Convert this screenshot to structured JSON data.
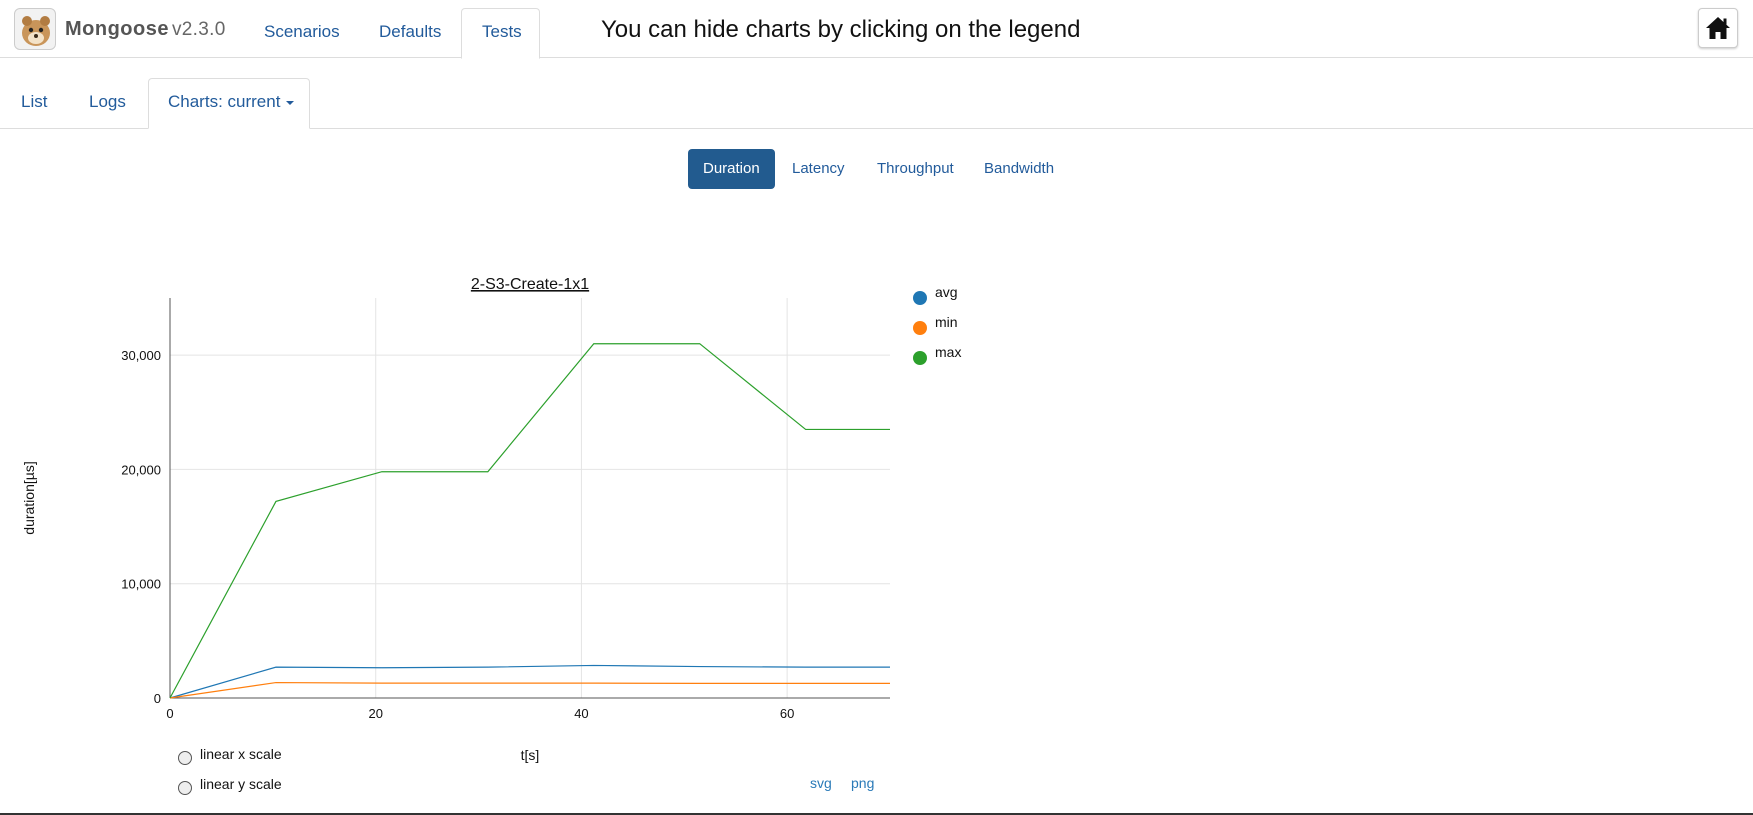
{
  "app": {
    "brand": "Mongoose",
    "version": "v2.3.0",
    "hint": "You can hide charts by clicking on the legend"
  },
  "topnav": {
    "items": [
      "Scenarios",
      "Defaults",
      "Tests"
    ],
    "active": "Tests"
  },
  "subtabs": {
    "items": [
      "List",
      "Logs",
      "Charts: current"
    ],
    "active": "Charts: current"
  },
  "metrics": {
    "items": [
      "Duration",
      "Latency",
      "Throughput",
      "Bandwidth"
    ],
    "active": "Duration"
  },
  "controls": {
    "linear_x": "linear x scale",
    "linear_y": "linear y scale",
    "export_svg": "svg",
    "export_png": "png"
  },
  "colors": {
    "avg": "#1f77b4",
    "min": "#ff7f0e",
    "max": "#2ca02c",
    "accent": "#225b8f"
  },
  "chart_data": {
    "type": "line",
    "title": "2-S3-Create-1x1",
    "xlabel": "t[s]",
    "ylabel": "duration[µs]",
    "xlim": [
      0,
      70
    ],
    "ylim": [
      0,
      35000
    ],
    "xticks": [
      0,
      20,
      40,
      60
    ],
    "yticks": [
      0,
      10000,
      20000,
      30000
    ],
    "ytick_labels": [
      "0",
      "10,000",
      "20,000",
      "30,000"
    ],
    "grid": true,
    "legend_position": "right",
    "x": [
      0,
      10.3,
      20.6,
      30.9,
      41.2,
      51.5,
      61.8,
      70
    ],
    "series": [
      {
        "name": "avg",
        "values": [
          0,
          2700,
          2650,
          2700,
          2850,
          2750,
          2700,
          2700
        ]
      },
      {
        "name": "min",
        "values": [
          0,
          1350,
          1300,
          1300,
          1300,
          1280,
          1280,
          1280
        ]
      },
      {
        "name": "max",
        "values": [
          0,
          17200,
          19800,
          19800,
          31000,
          31000,
          23500,
          23500
        ]
      }
    ]
  }
}
